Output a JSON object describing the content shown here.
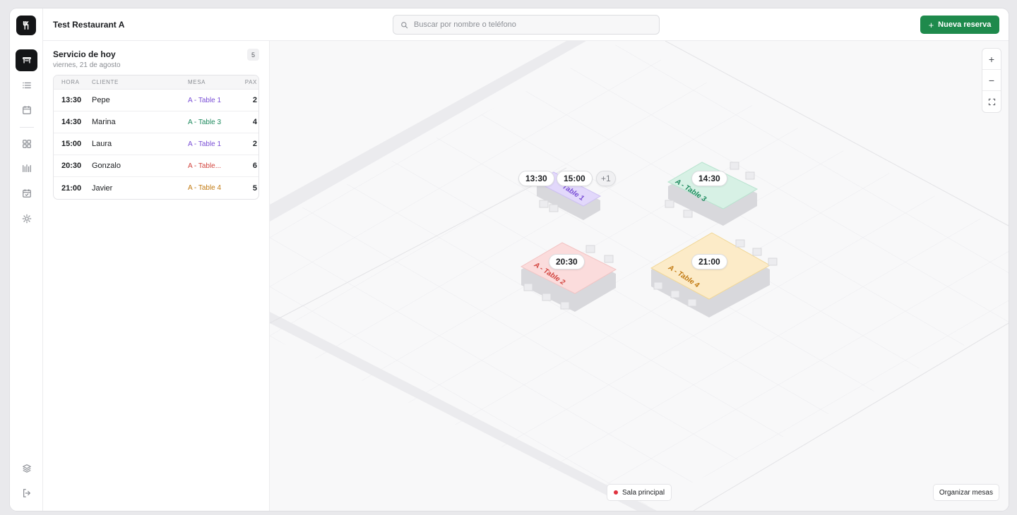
{
  "header": {
    "restaurant_name": "Test Restaurant A",
    "search_placeholder": "Buscar por nombre o teléfono",
    "new_reservation_label": "Nueva reserva"
  },
  "sidebar": {
    "icons": [
      "logo-fork-knife-icon",
      "floor-plan-icon",
      "list-icon",
      "calendar-icon",
      "grid-icon",
      "bars-chart-icon",
      "calendar-check-icon",
      "settings-icon",
      "layers-icon",
      "logout-icon"
    ],
    "active": "floor-plan-icon"
  },
  "service": {
    "title": "Servicio de hoy",
    "date": "viernes, 21 de agosto",
    "count": "5",
    "columns": {
      "time": "HORA",
      "client": "CLIENTE",
      "table": "MESA",
      "pax": "PAX"
    },
    "rows": [
      {
        "time": "13:30",
        "client": "Pepe",
        "table": "A - Table 1",
        "pax": "2",
        "color": "#7a4fd6"
      },
      {
        "time": "14:30",
        "client": "Marina",
        "table": "A - Table 3",
        "pax": "4",
        "color": "#1e8a5e"
      },
      {
        "time": "15:00",
        "client": "Laura",
        "table": "A - Table 1",
        "pax": "2",
        "color": "#7a4fd6"
      },
      {
        "time": "20:30",
        "client": "Gonzalo",
        "table": "A - Table...",
        "pax": "6",
        "color": "#d2453f"
      },
      {
        "time": "21:00",
        "client": "Javier",
        "table": "A - Table 4",
        "pax": "5",
        "color": "#c27a12"
      }
    ]
  },
  "floor": {
    "room_name": "Sala principal",
    "organize_label": "Organizar mesas",
    "zoom_in": "+",
    "zoom_out": "−",
    "tables": [
      {
        "label": "A - Table 1",
        "label_lines": [
          "A -",
          "Table 1"
        ],
        "color": "#e2d8fb",
        "text_color": "#7a4fd6",
        "times": [
          "13:30",
          "15:00"
        ],
        "more": "+1"
      },
      {
        "label": "A - Table 3",
        "color": "#d7f1e5",
        "text_color": "#1e8a5e",
        "times": [
          "14:30"
        ]
      },
      {
        "label": "A - Table 2",
        "color": "#fbdcdc",
        "text_color": "#d2453f",
        "times": [
          "20:30"
        ]
      },
      {
        "label": "A - Table 4",
        "color": "#fcebc8",
        "text_color": "#c27a12",
        "times": [
          "21:00"
        ]
      }
    ]
  }
}
